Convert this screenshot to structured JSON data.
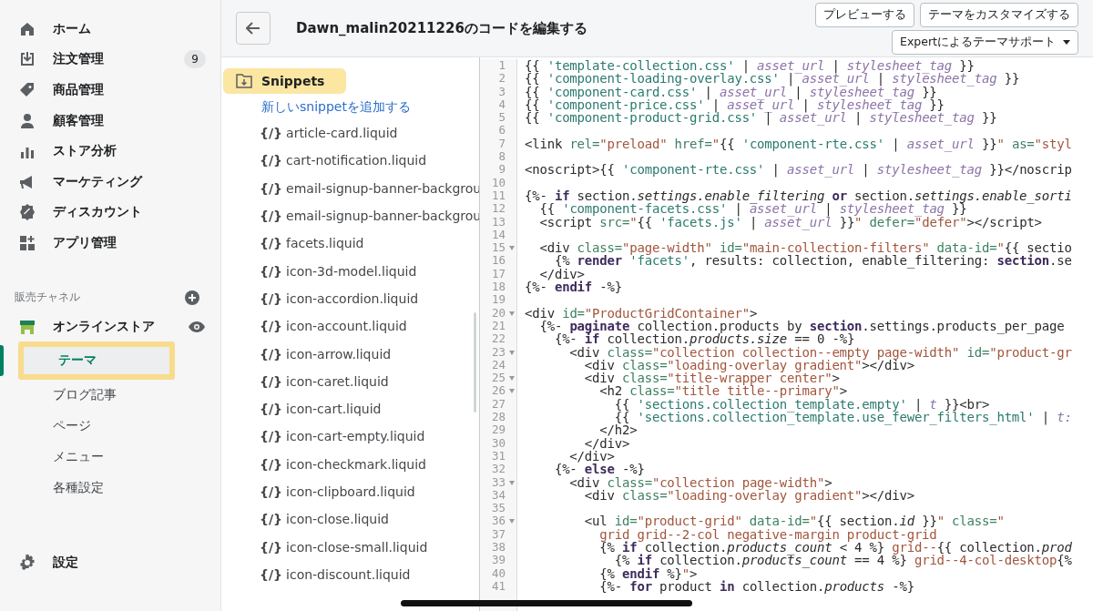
{
  "sidebar": {
    "items": [
      {
        "label": "ホーム"
      },
      {
        "label": "注文管理",
        "badge": "9"
      },
      {
        "label": "商品管理"
      },
      {
        "label": "顧客管理"
      },
      {
        "label": "ストア分析"
      },
      {
        "label": "マーケティング"
      },
      {
        "label": "ディスカウント"
      },
      {
        "label": "アプリ管理"
      }
    ],
    "channels_heading": "販売チャネル",
    "channel": {
      "label": "オンラインストア",
      "children": [
        {
          "label": "テーマ",
          "selected": true,
          "highlighted": true
        },
        {
          "label": "ブログ記事",
          "selected": false,
          "highlighted": false
        },
        {
          "label": "ページ",
          "selected": false,
          "highlighted": false
        },
        {
          "label": "メニュー",
          "selected": false,
          "highlighted": false
        },
        {
          "label": "各種設定",
          "selected": false,
          "highlighted": false
        }
      ]
    },
    "settings": "設定"
  },
  "header": {
    "title": "Dawn_malin20211226のコードを編集する",
    "buttons": [
      "プレビューする",
      "テーマをカスタマイズする"
    ],
    "dropdown": "Expertによるテーマサポート"
  },
  "files": {
    "folder": {
      "label": "Snippets",
      "highlighted": true
    },
    "add_link": "新しいsnippetを追加する",
    "items": [
      {
        "glyph": "{/}",
        "name": "article-card.liquid"
      },
      {
        "glyph": "{/}",
        "name": "cart-notification.liquid"
      },
      {
        "glyph": "{/}",
        "name": "email-signup-banner-backgrou"
      },
      {
        "glyph": "{/}",
        "name": "email-signup-banner-backgrou"
      },
      {
        "glyph": "{/}",
        "name": "facets.liquid"
      },
      {
        "glyph": "{/}",
        "name": "icon-3d-model.liquid"
      },
      {
        "glyph": "{/}",
        "name": "icon-accordion.liquid"
      },
      {
        "glyph": "{/}",
        "name": "icon-account.liquid"
      },
      {
        "glyph": "{/}",
        "name": "icon-arrow.liquid"
      },
      {
        "glyph": "{/}",
        "name": "icon-caret.liquid"
      },
      {
        "glyph": "{/}",
        "name": "icon-cart.liquid"
      },
      {
        "glyph": "{/}",
        "name": "icon-cart-empty.liquid"
      },
      {
        "glyph": "{/}",
        "name": "icon-checkmark.liquid"
      },
      {
        "glyph": "{/}",
        "name": "icon-clipboard.liquid"
      },
      {
        "glyph": "{/}",
        "name": "icon-close.liquid"
      },
      {
        "glyph": "{/}",
        "name": "icon-close-small.liquid"
      },
      {
        "glyph": "{/}",
        "name": "icon-discount.liquid"
      }
    ]
  },
  "code": [
    {
      "number": "1",
      "fold": false,
      "tokens": [
        {
          "kind": "plain",
          "text": "{{ "
        },
        {
          "kind": "string",
          "text": "'template-collection.css'"
        },
        {
          "kind": "plain",
          "text": " | "
        },
        {
          "kind": "filter",
          "text": "asset_url"
        },
        {
          "kind": "plain",
          "text": " | "
        },
        {
          "kind": "filter",
          "text": "stylesheet_tag"
        },
        {
          "kind": "plain",
          "text": " }}"
        }
      ]
    },
    {
      "number": "2",
      "fold": false,
      "tokens": [
        {
          "kind": "plain",
          "text": "{{ "
        },
        {
          "kind": "string",
          "text": "'component-loading-overlay.css'"
        },
        {
          "kind": "plain",
          "text": " | "
        },
        {
          "kind": "filter",
          "text": "asset_url"
        },
        {
          "kind": "plain",
          "text": " | "
        },
        {
          "kind": "filter",
          "text": "stylesheet_tag"
        },
        {
          "kind": "plain",
          "text": " }}"
        }
      ]
    },
    {
      "number": "3",
      "fold": false,
      "tokens": [
        {
          "kind": "plain",
          "text": "{{ "
        },
        {
          "kind": "string",
          "text": "'component-card.css'"
        },
        {
          "kind": "plain",
          "text": " | "
        },
        {
          "kind": "filter",
          "text": "asset_url"
        },
        {
          "kind": "plain",
          "text": " | "
        },
        {
          "kind": "filter",
          "text": "stylesheet_tag"
        },
        {
          "kind": "plain",
          "text": " }}"
        }
      ]
    },
    {
      "number": "4",
      "fold": false,
      "tokens": [
        {
          "kind": "plain",
          "text": "{{ "
        },
        {
          "kind": "string",
          "text": "'component-price.css'"
        },
        {
          "kind": "plain",
          "text": " | "
        },
        {
          "kind": "filter",
          "text": "asset_url"
        },
        {
          "kind": "plain",
          "text": " | "
        },
        {
          "kind": "filter",
          "text": "stylesheet_tag"
        },
        {
          "kind": "plain",
          "text": " }}"
        }
      ]
    },
    {
      "number": "5",
      "fold": false,
      "tokens": [
        {
          "kind": "plain",
          "text": "{{ "
        },
        {
          "kind": "string",
          "text": "'component-product-grid.css'"
        },
        {
          "kind": "plain",
          "text": " | "
        },
        {
          "kind": "filter",
          "text": "asset_url"
        },
        {
          "kind": "plain",
          "text": " | "
        },
        {
          "kind": "filter",
          "text": "stylesheet_tag"
        },
        {
          "kind": "plain",
          "text": " }}"
        }
      ]
    },
    {
      "number": "6",
      "fold": false
    },
    {
      "number": "7",
      "fold": false,
      "tokens": [
        {
          "kind": "plain",
          "text": "<link "
        },
        {
          "kind": "attr",
          "text": "rel="
        },
        {
          "kind": "value",
          "text": "\"preload\""
        },
        {
          "kind": "attr",
          "text": " href="
        },
        {
          "kind": "value",
          "text": "\""
        },
        {
          "kind": "plain",
          "text": "{{ "
        },
        {
          "kind": "string",
          "text": "'component-rte.css'"
        },
        {
          "kind": "plain",
          "text": " | "
        },
        {
          "kind": "filter",
          "text": "asset_url"
        },
        {
          "kind": "plain",
          "text": " }}"
        },
        {
          "kind": "value",
          "text": "\""
        },
        {
          "kind": "attr",
          "text": " as="
        },
        {
          "kind": "value",
          "text": "\"styl"
        }
      ]
    },
    {
      "number": "8",
      "fold": false
    },
    {
      "number": "9",
      "fold": false,
      "tokens": [
        {
          "kind": "plain",
          "text": "<noscript>{{ "
        },
        {
          "kind": "string",
          "text": "'component-rte.css'"
        },
        {
          "kind": "plain",
          "text": " | "
        },
        {
          "kind": "filter",
          "text": "asset_url"
        },
        {
          "kind": "plain",
          "text": " | "
        },
        {
          "kind": "filter",
          "text": "stylesheet_tag"
        },
        {
          "kind": "plain",
          "text": " }}</noscrip"
        }
      ]
    },
    {
      "number": "10",
      "fold": false
    },
    {
      "number": "11",
      "fold": false,
      "tokens": [
        {
          "kind": "plain",
          "text": "{%- "
        },
        {
          "kind": "keyword",
          "text": "if"
        },
        {
          "kind": "plain",
          "text": " section."
        },
        {
          "kind": "italic",
          "text": "settings.enable_filtering"
        },
        {
          "kind": "keyword",
          "text": " or"
        },
        {
          "kind": "plain",
          "text": " section."
        },
        {
          "kind": "italic",
          "text": "settings.enable_sorti"
        }
      ]
    },
    {
      "number": "12",
      "fold": false,
      "tokens": [
        {
          "kind": "plain",
          "text": "  {{ "
        },
        {
          "kind": "string",
          "text": "'component-facets.css'"
        },
        {
          "kind": "plain",
          "text": " | "
        },
        {
          "kind": "filter",
          "text": "asset_url"
        },
        {
          "kind": "plain",
          "text": " | "
        },
        {
          "kind": "filter",
          "text": "stylesheet_tag"
        },
        {
          "kind": "plain",
          "text": " }}"
        }
      ]
    },
    {
      "number": "13",
      "fold": false,
      "tokens": [
        {
          "kind": "plain",
          "text": "  <script "
        },
        {
          "kind": "attr",
          "text": "src="
        },
        {
          "kind": "value",
          "text": "\""
        },
        {
          "kind": "plain",
          "text": "{{ "
        },
        {
          "kind": "string",
          "text": "'facets.js'"
        },
        {
          "kind": "plain",
          "text": " | "
        },
        {
          "kind": "filter",
          "text": "asset_url"
        },
        {
          "kind": "plain",
          "text": " }}"
        },
        {
          "kind": "value",
          "text": "\""
        },
        {
          "kind": "attr",
          "text": " defer="
        },
        {
          "kind": "value",
          "text": "\"defer\""
        },
        {
          "kind": "plain",
          "text": "></script>"
        }
      ]
    },
    {
      "number": "14",
      "fold": false
    },
    {
      "number": "15",
      "fold": true,
      "tokens": [
        {
          "kind": "plain",
          "text": "  <div "
        },
        {
          "kind": "attr",
          "text": "class="
        },
        {
          "kind": "value",
          "text": "\"page-width\""
        },
        {
          "kind": "attr",
          "text": " id="
        },
        {
          "kind": "value",
          "text": "\"main-collection-filters\""
        },
        {
          "kind": "attr",
          "text": " data-id="
        },
        {
          "kind": "value",
          "text": "\""
        },
        {
          "kind": "plain",
          "text": "{{ sectio"
        }
      ]
    },
    {
      "number": "16",
      "fold": false,
      "tokens": [
        {
          "kind": "plain",
          "text": "    {% "
        },
        {
          "kind": "keyword",
          "text": "render "
        },
        {
          "kind": "string",
          "text": "'facets'"
        },
        {
          "kind": "plain",
          "text": ", results: collection, enable_filtering: "
        },
        {
          "kind": "keyword",
          "text": "section"
        },
        {
          "kind": "plain",
          "text": ".se"
        }
      ]
    },
    {
      "number": "17",
      "fold": false,
      "tokens": [
        {
          "kind": "plain",
          "text": "  </div>"
        }
      ]
    },
    {
      "number": "18",
      "fold": false,
      "tokens": [
        {
          "kind": "plain",
          "text": "{%- "
        },
        {
          "kind": "keyword",
          "text": "endif"
        },
        {
          "kind": "plain",
          "text": " -%}"
        }
      ]
    },
    {
      "number": "19",
      "fold": false
    },
    {
      "number": "20",
      "fold": true,
      "tokens": [
        {
          "kind": "plain",
          "text": "<div "
        },
        {
          "kind": "attr",
          "text": "id="
        },
        {
          "kind": "value",
          "text": "\"ProductGridContainer\""
        },
        {
          "kind": "plain",
          "text": ">"
        }
      ]
    },
    {
      "number": "21",
      "fold": false,
      "tokens": [
        {
          "kind": "plain",
          "text": "  {%- "
        },
        {
          "kind": "keyword",
          "text": "paginate"
        },
        {
          "kind": "plain",
          "text": " collection.products by "
        },
        {
          "kind": "keyword",
          "text": "section"
        },
        {
          "kind": "plain",
          "text": ".settings.products_per_page"
        }
      ]
    },
    {
      "number": "22",
      "fold": false,
      "tokens": [
        {
          "kind": "plain",
          "text": "    {%- "
        },
        {
          "kind": "keyword",
          "text": "if"
        },
        {
          "kind": "plain",
          "text": " collection."
        },
        {
          "kind": "italic",
          "text": "products.size"
        },
        {
          "kind": "plain",
          "text": " == 0 -%}"
        }
      ]
    },
    {
      "number": "23",
      "fold": true,
      "tokens": [
        {
          "kind": "plain",
          "text": "      <div "
        },
        {
          "kind": "attr",
          "text": "class="
        },
        {
          "kind": "value",
          "text": "\"collection collection--empty page-width\""
        },
        {
          "kind": "attr",
          "text": " id="
        },
        {
          "kind": "value",
          "text": "\"product-gr"
        }
      ]
    },
    {
      "number": "24",
      "fold": false,
      "tokens": [
        {
          "kind": "plain",
          "text": "        <div "
        },
        {
          "kind": "attr",
          "text": "class="
        },
        {
          "kind": "value",
          "text": "\"loading-overlay gradient\""
        },
        {
          "kind": "plain",
          "text": "></div>"
        }
      ]
    },
    {
      "number": "25",
      "fold": true,
      "tokens": [
        {
          "kind": "plain",
          "text": "        <div "
        },
        {
          "kind": "attr",
          "text": "class="
        },
        {
          "kind": "value",
          "text": "\"title-wrapper center\""
        },
        {
          "kind": "plain",
          "text": ">"
        }
      ]
    },
    {
      "number": "26",
      "fold": true,
      "tokens": [
        {
          "kind": "plain",
          "text": "          <h2 "
        },
        {
          "kind": "attr",
          "text": "class="
        },
        {
          "kind": "value",
          "text": "\"title title--primary\""
        },
        {
          "kind": "plain",
          "text": ">"
        }
      ]
    },
    {
      "number": "27",
      "fold": false,
      "tokens": [
        {
          "kind": "plain",
          "text": "            {{ "
        },
        {
          "kind": "string",
          "text": "'sections.collection_template.empty'"
        },
        {
          "kind": "plain",
          "text": " | "
        },
        {
          "kind": "filter",
          "text": "t"
        },
        {
          "kind": "plain",
          "text": " }}<br>"
        }
      ]
    },
    {
      "number": "28",
      "fold": false,
      "tokens": [
        {
          "kind": "plain",
          "text": "            {{ "
        },
        {
          "kind": "string",
          "text": "'sections.collection_template.use_fewer_filters_html'"
        },
        {
          "kind": "plain",
          "text": " | "
        },
        {
          "kind": "filter",
          "text": "t:"
        }
      ]
    },
    {
      "number": "29",
      "fold": false,
      "tokens": [
        {
          "kind": "plain",
          "text": "          </h2>"
        }
      ]
    },
    {
      "number": "30",
      "fold": false,
      "tokens": [
        {
          "kind": "plain",
          "text": "        </div>"
        }
      ]
    },
    {
      "number": "31",
      "fold": false,
      "tokens": [
        {
          "kind": "plain",
          "text": "      </div>"
        }
      ]
    },
    {
      "number": "32",
      "fold": false,
      "tokens": [
        {
          "kind": "plain",
          "text": "    {%- "
        },
        {
          "kind": "keyword",
          "text": "else"
        },
        {
          "kind": "plain",
          "text": " -%}"
        }
      ]
    },
    {
      "number": "33",
      "fold": true,
      "tokens": [
        {
          "kind": "plain",
          "text": "      <div "
        },
        {
          "kind": "attr",
          "text": "class="
        },
        {
          "kind": "value",
          "text": "\"collection page-width\""
        },
        {
          "kind": "plain",
          "text": ">"
        }
      ]
    },
    {
      "number": "34",
      "fold": false,
      "tokens": [
        {
          "kind": "plain",
          "text": "        <div "
        },
        {
          "kind": "attr",
          "text": "class="
        },
        {
          "kind": "value",
          "text": "\"loading-overlay gradient\""
        },
        {
          "kind": "plain",
          "text": "></div>"
        }
      ]
    },
    {
      "number": "35",
      "fold": false
    },
    {
      "number": "36",
      "fold": true,
      "tokens": [
        {
          "kind": "plain",
          "text": "        <ul "
        },
        {
          "kind": "attr",
          "text": "id="
        },
        {
          "kind": "value",
          "text": "\"product-grid\""
        },
        {
          "kind": "attr",
          "text": " data-id="
        },
        {
          "kind": "value",
          "text": "\""
        },
        {
          "kind": "plain",
          "text": "{{ section."
        },
        {
          "kind": "italic",
          "text": "id"
        },
        {
          "kind": "plain",
          "text": " }}"
        },
        {
          "kind": "value",
          "text": "\""
        },
        {
          "kind": "attr",
          "text": " class="
        },
        {
          "kind": "value",
          "text": "\""
        }
      ]
    },
    {
      "number": "37",
      "fold": false,
      "tokens": [
        {
          "kind": "value",
          "text": "          grid grid--2-col negative-margin product-grid"
        }
      ]
    },
    {
      "number": "38",
      "fold": false,
      "tokens": [
        {
          "kind": "plain",
          "text": "          {% "
        },
        {
          "kind": "keyword",
          "text": "if"
        },
        {
          "kind": "plain",
          "text": " collection."
        },
        {
          "kind": "italic",
          "text": "products_count"
        },
        {
          "kind": "plain",
          "text": " < 4 %} "
        },
        {
          "kind": "value",
          "text": "grid--"
        },
        {
          "kind": "plain",
          "text": "{{ collection."
        },
        {
          "kind": "italic",
          "text": "prod"
        }
      ]
    },
    {
      "number": "39",
      "fold": false,
      "tokens": [
        {
          "kind": "plain",
          "text": "            {% "
        },
        {
          "kind": "keyword",
          "text": "if"
        },
        {
          "kind": "plain",
          "text": " collection."
        },
        {
          "kind": "italic",
          "text": "products_count"
        },
        {
          "kind": "plain",
          "text": " == 4 %} "
        },
        {
          "kind": "value",
          "text": "grid--4-col-desktop"
        },
        {
          "kind": "plain",
          "text": "{%"
        }
      ]
    },
    {
      "number": "40",
      "fold": false,
      "tokens": [
        {
          "kind": "plain",
          "text": "          {% "
        },
        {
          "kind": "keyword",
          "text": "endif"
        },
        {
          "kind": "plain",
          "text": " %}"
        },
        {
          "kind": "value",
          "text": "\""
        },
        {
          "kind": "plain",
          "text": ">"
        }
      ]
    },
    {
      "number": "41",
      "fold": false,
      "tokens": [
        {
          "kind": "plain",
          "text": "          {%- "
        },
        {
          "kind": "keyword",
          "text": "for"
        },
        {
          "kind": "plain",
          "text": " product "
        },
        {
          "kind": "keyword",
          "text": "in"
        },
        {
          "kind": "plain",
          "text": " collection."
        },
        {
          "kind": "italic",
          "text": "products"
        },
        {
          "kind": "plain",
          "text": " -%}"
        }
      ]
    }
  ]
}
